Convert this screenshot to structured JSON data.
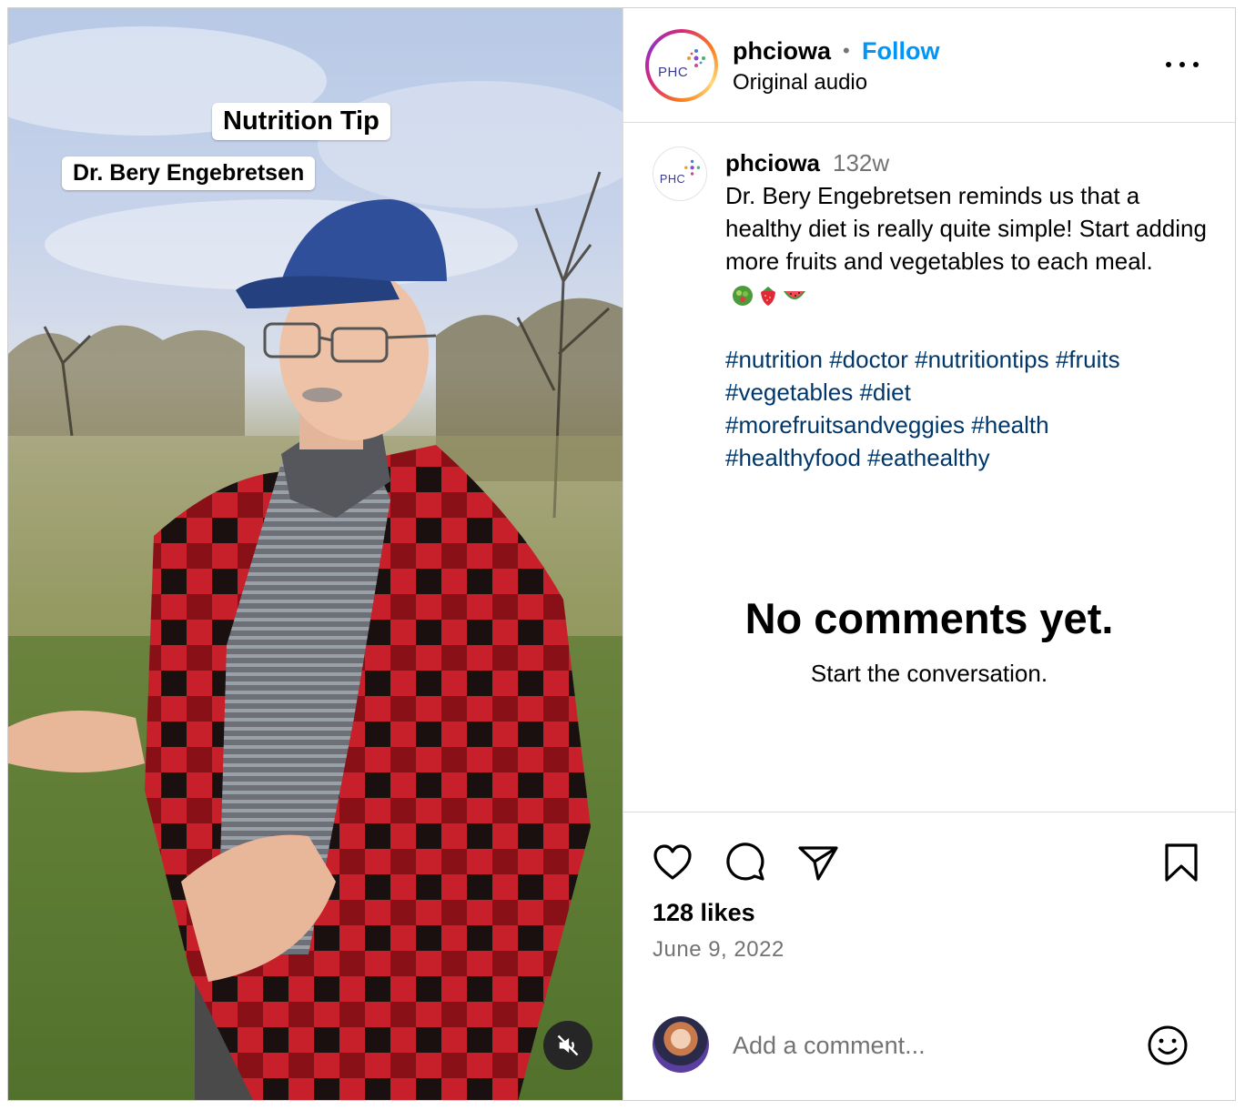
{
  "media": {
    "overlay_title": "Nutrition Tip",
    "overlay_name": "Dr. Bery Engebretsen",
    "mute_icon": "speaker-muted-icon"
  },
  "header": {
    "username": "phciowa",
    "separator": "•",
    "follow_label": "Follow",
    "audio_label": "Original audio",
    "avatar_logo_text": "PHC",
    "more_icon": "more-options-icon"
  },
  "caption": {
    "username": "phciowa",
    "time": "132w",
    "text": "Dr. Bery Engebretsen reminds us that a healthy diet is really quite simple! Start adding more fruits and vegetables to each meal.",
    "emojis": [
      "salad-emoji",
      "strawberry-emoji",
      "watermelon-emoji"
    ],
    "hashtags": [
      "#nutrition",
      "#doctor",
      "#nutritiontips",
      "#fruits",
      "#vegetables",
      "#diet",
      "#morefruitsandveggies",
      "#health",
      "#healthyfood",
      "#eathealthy"
    ]
  },
  "comments": {
    "empty_title": "No comments yet.",
    "empty_subtitle": "Start the conversation."
  },
  "actions": {
    "like_icon": "heart-icon",
    "comment_icon": "comment-bubble-icon",
    "share_icon": "paper-plane-icon",
    "save_icon": "bookmark-icon"
  },
  "stats": {
    "likes": "128 likes",
    "date": "June 9, 2022"
  },
  "add_comment": {
    "placeholder": "Add a comment...",
    "emoji_icon": "smiley-icon"
  },
  "colors": {
    "follow": "#0095f6",
    "hashtag": "#00376b",
    "secondary_text": "#737373",
    "divider": "#dbdbdb"
  }
}
